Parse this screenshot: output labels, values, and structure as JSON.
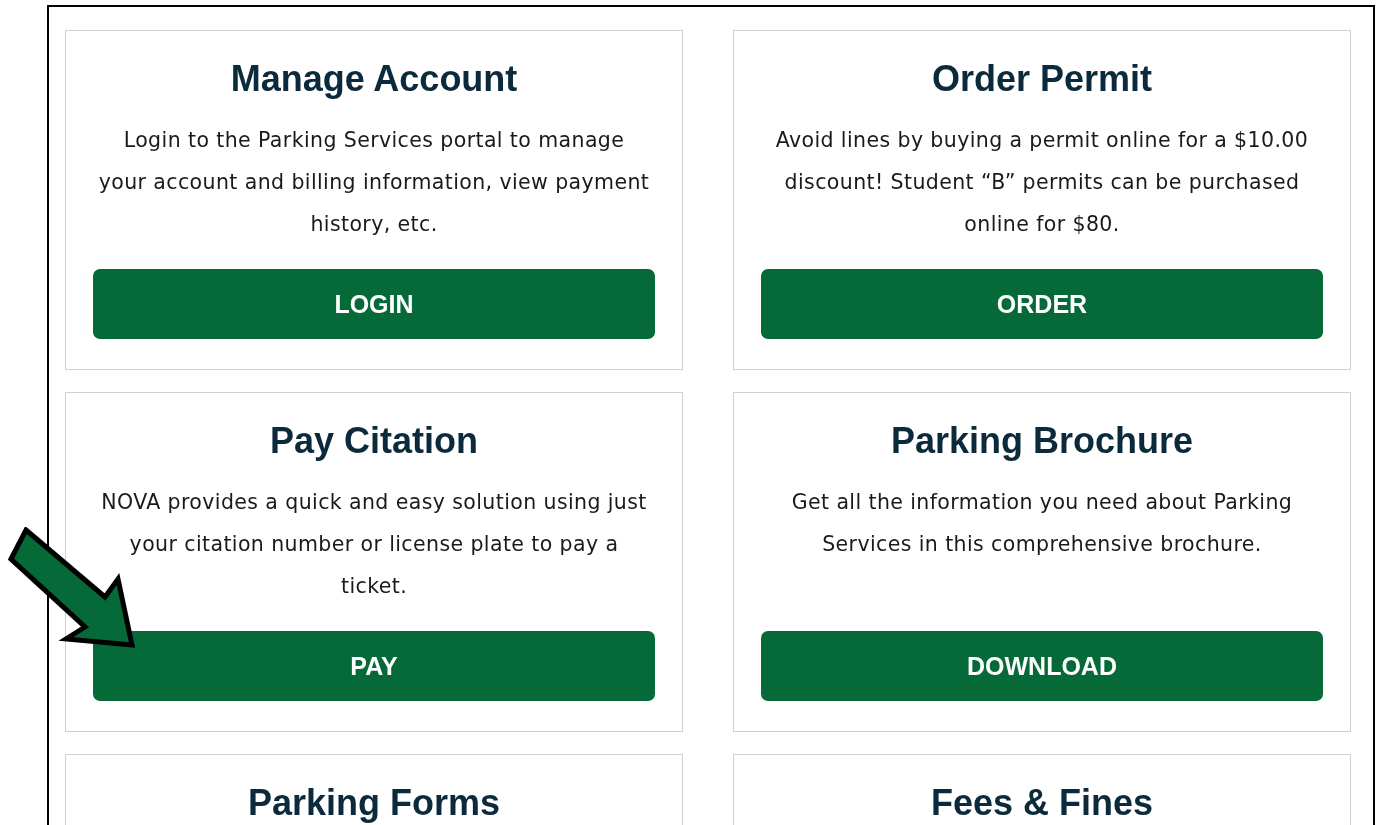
{
  "cards": [
    {
      "title": "Manage Account",
      "description": "Login to the Parking Services portal to manage your account and billing information, view payment history, etc.",
      "button": "LOGIN"
    },
    {
      "title": "Order Permit",
      "description": "Avoid lines by buying a permit online for a $10.00 discount! Student “B” permits can be purchased online for $80.",
      "button": "ORDER"
    },
    {
      "title": "Pay Citation",
      "description": "NOVA provides a quick and easy solution using just your citation number or license plate to pay a ticket.",
      "button": "PAY"
    },
    {
      "title": "Parking Brochure",
      "description": "Get all the information you need about Parking Services in this comprehensive brochure.",
      "button": "DOWNLOAD"
    },
    {
      "title": "Parking Forms"
    },
    {
      "title": "Fees & Fines"
    }
  ]
}
